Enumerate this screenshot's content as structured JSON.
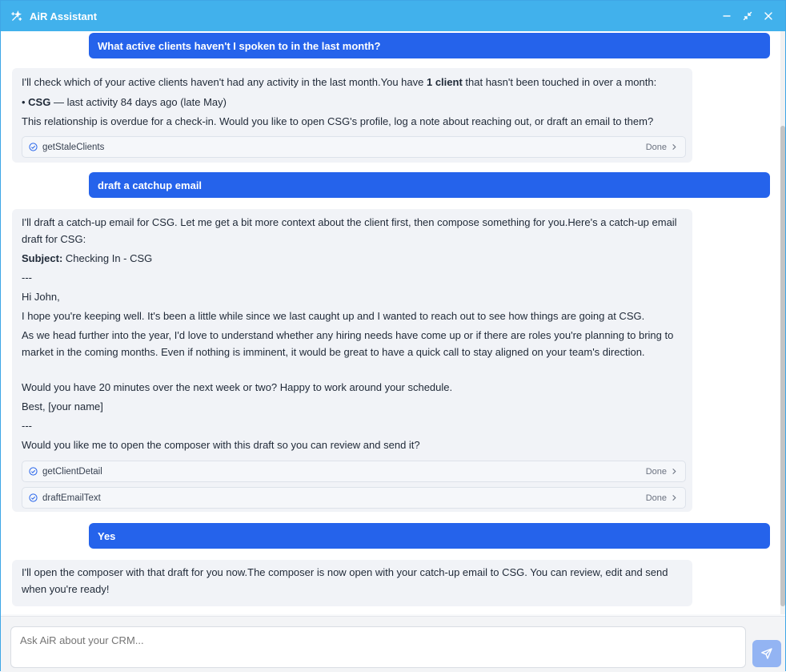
{
  "window": {
    "title": "AiR Assistant",
    "icons": {
      "brand": "sparkle-icon",
      "minimize": "minimize-icon",
      "restore": "collapse-icon",
      "close": "close-icon"
    }
  },
  "messages": {
    "user1": "What active clients haven't I spoken to in the last month?",
    "bot1": {
      "line1_a": "I'll check which of your active clients haven't had any activity in the last month.You have ",
      "line1_b": "1 client",
      "line1_c": " that hasn't been touched in over a month:",
      "bullet_prefix": "• ",
      "bullet_bold": "CSG",
      "bullet_rest": " — last activity 84 days ago (late May)",
      "line3": "This relationship is overdue for a check-in. Would you like to open CSG's profile, log a note about reaching out, or draft an email to them?",
      "tools": [
        {
          "name": "getStaleClients",
          "status": "Done"
        }
      ]
    },
    "user2": "draft a catchup email",
    "bot2": {
      "intro": "I'll draft a catch-up email for CSG. Let me get a bit more context about the client first, then compose something for you.Here's a catch-up email draft for CSG:",
      "subject_label": "Subject:",
      "subject_value": " Checking In - CSG",
      "sep1": "---",
      "greeting": "Hi John,",
      "p1": "I hope you're keeping well. It's been a little while since we last caught up and I wanted to reach out to see how things are going at CSG.",
      "p2": "As we head further into the year, I'd love to understand whether any hiring needs have come up or if there are roles you're planning to bring to market in the coming months. Even if nothing is imminent, it would be great to have a quick call to stay aligned on your team's direction.",
      "p3": "Would you have 20 minutes over the next week or two? Happy to work around your schedule.",
      "signoff": "Best, [your name]",
      "sep2": "---",
      "question": "Would you like me to open the composer with this draft so you can review and send it?",
      "tools": [
        {
          "name": "getClientDetail",
          "status": "Done"
        },
        {
          "name": "draftEmailText",
          "status": "Done"
        }
      ]
    },
    "user3": "Yes",
    "bot3": "I'll open the composer with that draft for you now.The composer is now open with your catch-up email to CSG. You can review, edit and send when you're ready!"
  },
  "composer": {
    "placeholder": "Ask AiR about your CRM...",
    "send_icon": "send-icon"
  },
  "colors": {
    "titlebar": "#41b1ec",
    "user_bubble": "#2563eb",
    "bot_bubble": "#f1f3f7",
    "send_button": "#93b4f3"
  }
}
